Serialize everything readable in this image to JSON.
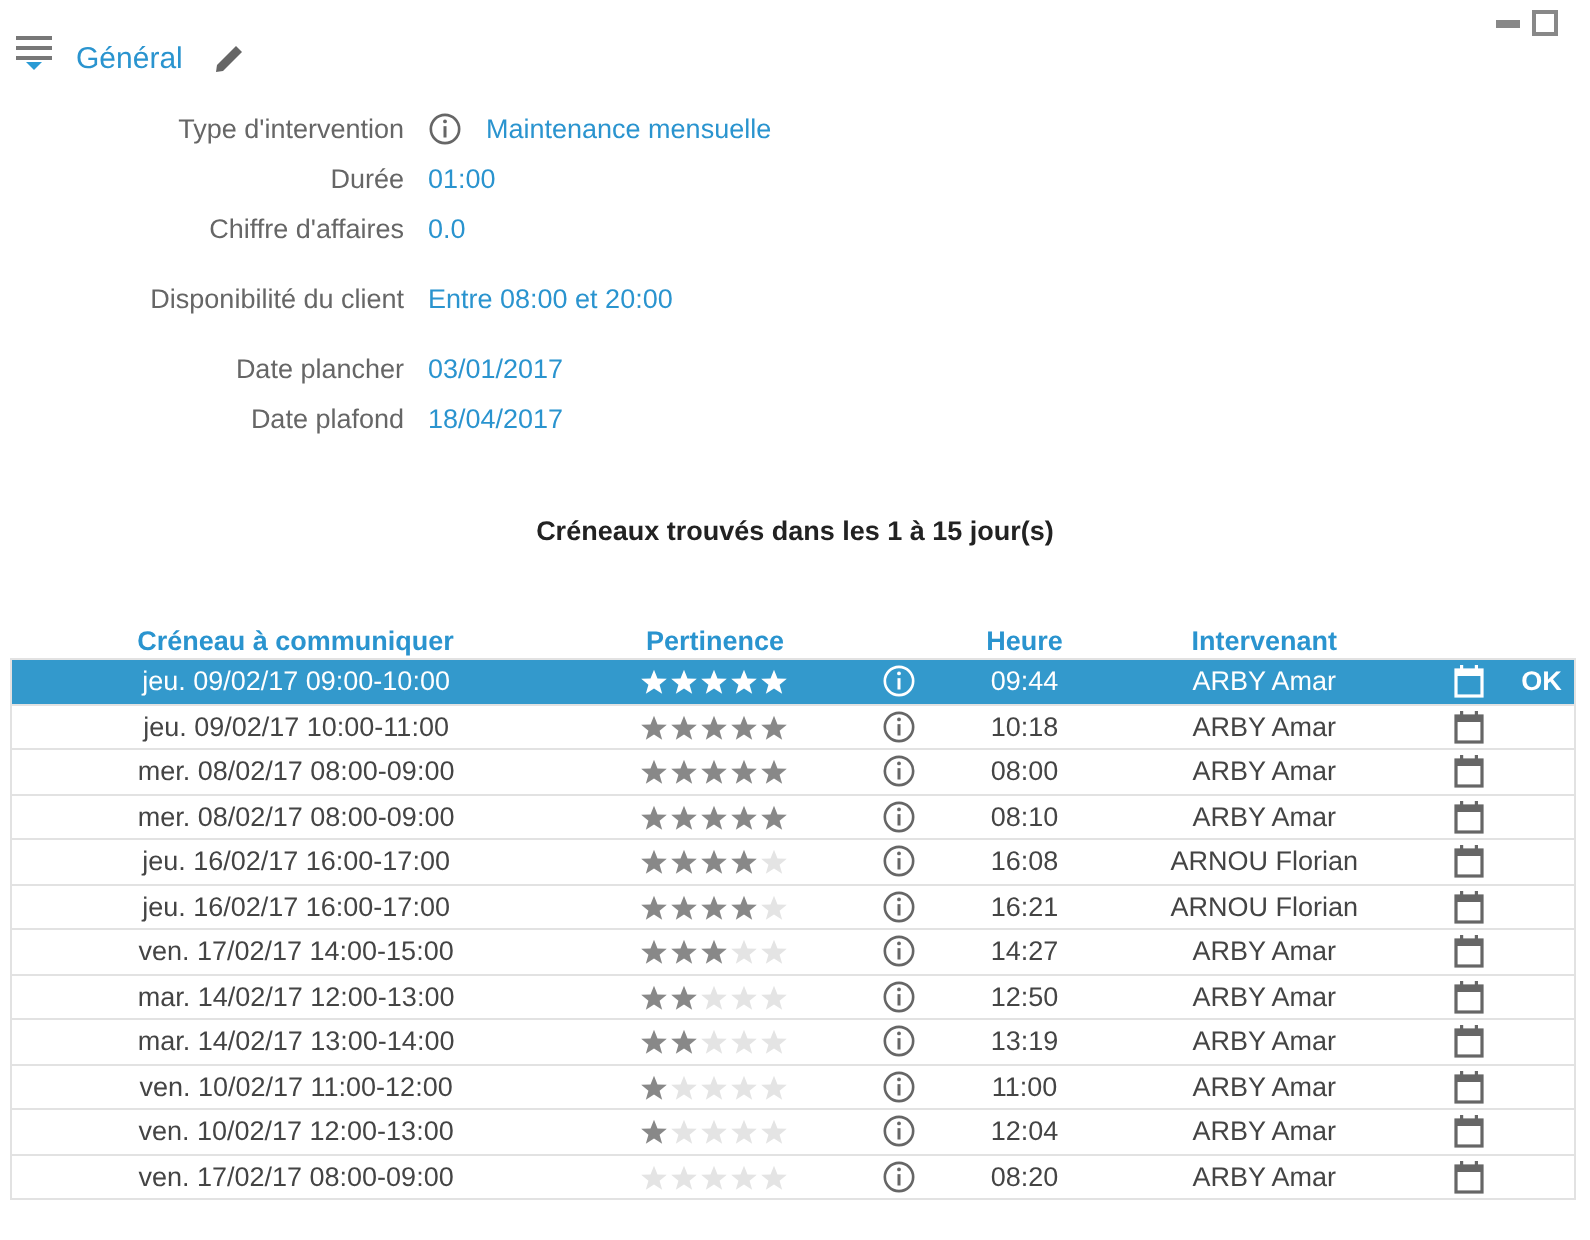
{
  "section": {
    "title": "Général"
  },
  "fields": [
    {
      "label": "Type d'intervention",
      "value": "Maintenance mensuelle",
      "info": true
    },
    {
      "label": "Durée",
      "value": "01:00",
      "info": false
    },
    {
      "label": "Chiffre d'affaires",
      "value": "0.0",
      "info": false
    },
    {
      "label": "Disponibilité du client",
      "value": "Entre 08:00 et 20:00",
      "info": false
    },
    {
      "label": "Date plancher",
      "value": "03/01/2017",
      "info": false
    },
    {
      "label": "Date plafond",
      "value": "18/04/2017",
      "info": false
    }
  ],
  "results_title": "Créneaux trouvés dans les 1 à 15 jour(s)",
  "table": {
    "columns": [
      "Créneau à communiquer",
      "Pertinence",
      "Heure",
      "Intervenant"
    ],
    "rows": [
      {
        "slot": "jeu. 09/02/17 09:00-10:00",
        "stars": 5,
        "time": "09:44",
        "technician": "ARBY Amar",
        "selected": true,
        "action": "OK"
      },
      {
        "slot": "jeu. 09/02/17 10:00-11:00",
        "stars": 5,
        "time": "10:18",
        "technician": "ARBY Amar",
        "selected": false
      },
      {
        "slot": "mer. 08/02/17 08:00-09:00",
        "stars": 5,
        "time": "08:00",
        "technician": "ARBY Amar",
        "selected": false
      },
      {
        "slot": "mer. 08/02/17 08:00-09:00",
        "stars": 5,
        "time": "08:10",
        "technician": "ARBY Amar",
        "selected": false
      },
      {
        "slot": "jeu. 16/02/17 16:00-17:00",
        "stars": 4,
        "time": "16:08",
        "technician": "ARNOU Florian",
        "selected": false
      },
      {
        "slot": "jeu. 16/02/17 16:00-17:00",
        "stars": 4,
        "time": "16:21",
        "technician": "ARNOU Florian",
        "selected": false
      },
      {
        "slot": "ven. 17/02/17 14:00-15:00",
        "stars": 3,
        "time": "14:27",
        "technician": "ARBY Amar",
        "selected": false
      },
      {
        "slot": "mar. 14/02/17 12:00-13:00",
        "stars": 2,
        "time": "12:50",
        "technician": "ARBY Amar",
        "selected": false
      },
      {
        "slot": "mar. 14/02/17 13:00-14:00",
        "stars": 2,
        "time": "13:19",
        "technician": "ARBY Amar",
        "selected": false
      },
      {
        "slot": "ven. 10/02/17 11:00-12:00",
        "stars": 1,
        "time": "11:00",
        "technician": "ARBY Amar",
        "selected": false
      },
      {
        "slot": "ven. 10/02/17 12:00-13:00",
        "stars": 1,
        "time": "12:04",
        "technician": "ARBY Amar",
        "selected": false
      },
      {
        "slot": "ven. 17/02/17 08:00-09:00",
        "stars": 0,
        "time": "08:20",
        "technician": "ARBY Amar",
        "selected": false
      }
    ]
  }
}
